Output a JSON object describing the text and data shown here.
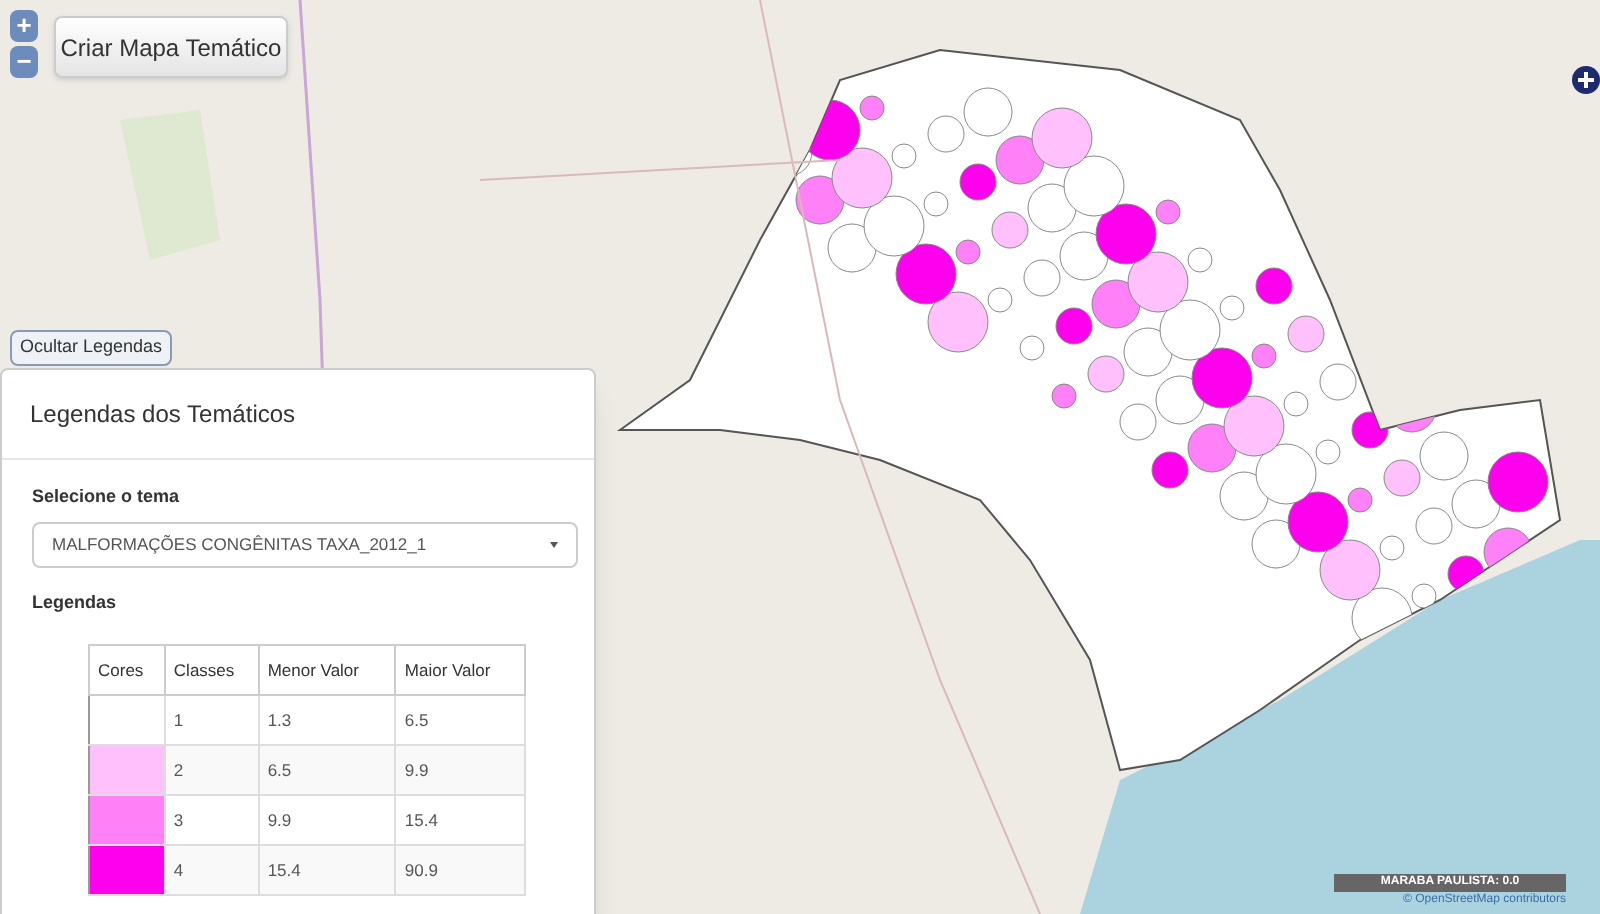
{
  "map_controls": {
    "zoom_in": "+",
    "zoom_out": "−"
  },
  "create_button": "Criar Mapa Temático",
  "toggle_button": "Ocultar Legendas",
  "legend_panel": {
    "title": "Legendas dos Temáticos",
    "theme_label": "Selecione o tema",
    "theme_value": "MALFORMAÇÕES CONGÊNITAS TAXA_2012_1",
    "legend_label": "Legendas",
    "columns": [
      "Cores",
      "Classes",
      "Menor Valor",
      "Maior Valor"
    ],
    "rows": [
      {
        "color": "#ffffff",
        "class": "1",
        "min": "1.3",
        "max": "6.5"
      },
      {
        "color": "#ffc0fb",
        "class": "2",
        "min": "6.5",
        "max": "9.9"
      },
      {
        "color": "#ff80f7",
        "class": "3",
        "min": "9.9",
        "max": "15.4"
      },
      {
        "color": "#ff00ee",
        "class": "4",
        "min": "15.4",
        "max": "90.9"
      }
    ]
  },
  "hover_label": "MARABA PAULISTA: 0.0",
  "attribution": "© OpenStreetMap contributors"
}
